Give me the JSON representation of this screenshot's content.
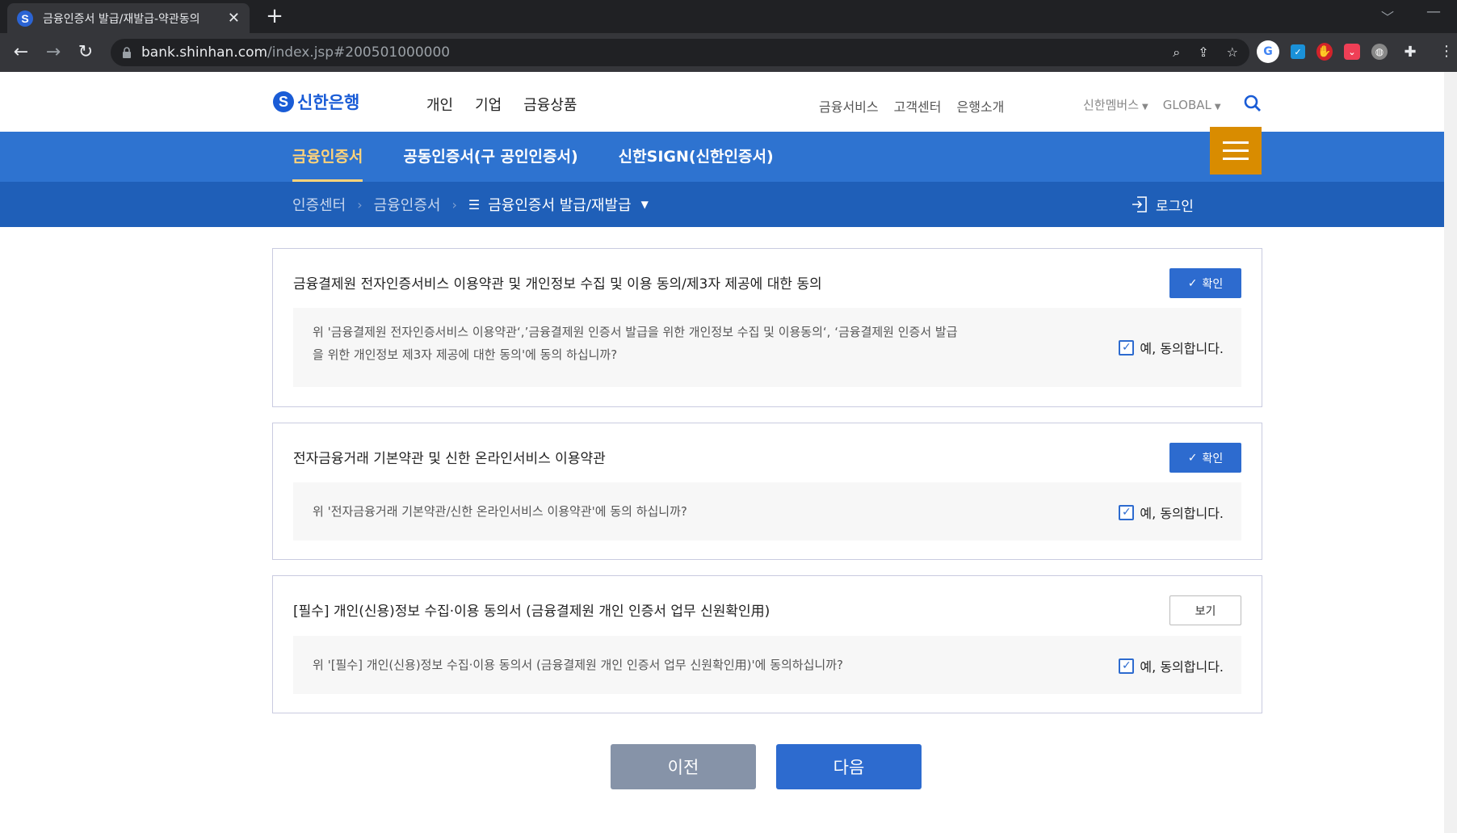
{
  "browser": {
    "tab_title": "금융인증서 발급/재발급-약관동의",
    "tab_favicon": "S",
    "url_host": "bank.shinhan.com",
    "url_path": "/index.jsp#200501000000"
  },
  "header": {
    "logo_text": "신한은행",
    "logo_mark": "S",
    "main_menu": [
      "개인",
      "기업",
      "금융상품"
    ],
    "sub_menu": [
      "금융서비스",
      "고객센터",
      "은행소개"
    ],
    "util_menu": [
      "신한멤버스",
      "GLOBAL"
    ]
  },
  "cert_tabs": [
    "금융인증서",
    "공동인증서(구 공인인증서)",
    "신한SIGN(신한인증서)"
  ],
  "breadcrumb": {
    "items": [
      "인증센터",
      "금융인증서"
    ],
    "current": "금융인증서 발급/재발급",
    "login_label": "로그인"
  },
  "agreements": [
    {
      "title": "금융결제원 전자인증서비스 이용약관 및 개인정보 수집 및 이용 동의/제3자 제공에 대한 동의",
      "button": "확인",
      "body_line1": "위 '금융결제원 전자인증서비스 이용약관‘,’금융결제원 인증서 발급을 위한 개인정보 수집 및 이용동의‘, ‘금융결제원 인증서 발급",
      "body_line2": "을 위한 개인정보 제3자 제공에 대한 동의'에 동의 하십니까?",
      "agree_label": "예, 동의합니다."
    },
    {
      "title": "전자금융거래 기본약관 및 신한 온라인서비스 이용약관",
      "button": "확인",
      "body_line1": "위 '전자금융거래 기본약관/신한 온라인서비스 이용약관'에 동의 하십니까?",
      "agree_label": "예, 동의합니다."
    },
    {
      "title": "[필수] 개인(신용)정보 수집·이용 동의서 (금융결제원 개인 인증서 업무 신원확인用)",
      "button": "보기",
      "body_line1": "위 '[필수] 개인(신용)정보 수집·이용 동의서 (금융결제원 개인 인증서 업무 신원확인用)'에 동의하십니까?",
      "agree_label": "예, 동의합니다."
    }
  ],
  "buttons": {
    "prev": "이전",
    "next": "다음"
  },
  "colors": {
    "brand": "#2e73d0",
    "accent": "#d98c00",
    "tab_active": "#ffd37a"
  }
}
